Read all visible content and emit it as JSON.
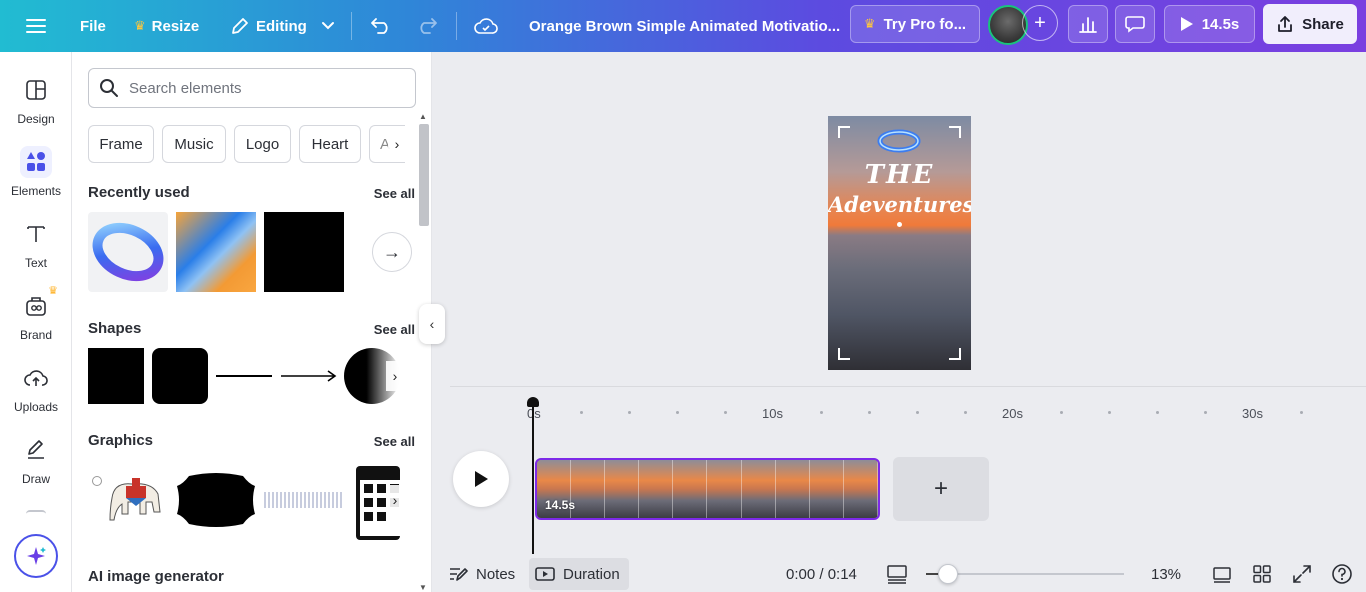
{
  "topbar": {
    "file_label": "File",
    "resize_label": "Resize",
    "editing_label": "Editing",
    "doc_title": "Orange Brown Simple Animated Motivatio...",
    "try_pro_label": "Try Pro fo...",
    "play_duration": "14.5s",
    "share_label": "Share"
  },
  "rail": {
    "items": [
      {
        "label": "Design",
        "icon": "layout-icon"
      },
      {
        "label": "Elements",
        "icon": "shapes-icon"
      },
      {
        "label": "Text",
        "icon": "text-icon"
      },
      {
        "label": "Brand",
        "icon": "brand-icon"
      },
      {
        "label": "Uploads",
        "icon": "cloud-upload-icon"
      },
      {
        "label": "Draw",
        "icon": "pen-icon"
      }
    ]
  },
  "panel": {
    "search_placeholder": "Search elements",
    "chips": [
      "Frame",
      "Music",
      "Logo",
      "Heart",
      "A"
    ],
    "recently_used": {
      "title": "Recently used",
      "see_all": "See all"
    },
    "shapes": {
      "title": "Shapes",
      "see_all": "See all"
    },
    "graphics": {
      "title": "Graphics",
      "see_all": "See all"
    },
    "ai_generator": {
      "title": "AI image generator"
    }
  },
  "design": {
    "line1": "THE",
    "line2": "Adeventures"
  },
  "timeline": {
    "ticks": [
      "0s",
      "10s",
      "20s",
      "30s"
    ],
    "clip_duration": "14.5s"
  },
  "bottom": {
    "notes_label": "Notes",
    "duration_label": "Duration",
    "time_readout": "0:00 / 0:14",
    "zoom": "13%",
    "zoom_level_fraction": 0.11
  },
  "colors": {
    "accent": "#7d2ae8",
    "topbar_start": "#21bcd2",
    "topbar_end": "#7a3fe0"
  }
}
